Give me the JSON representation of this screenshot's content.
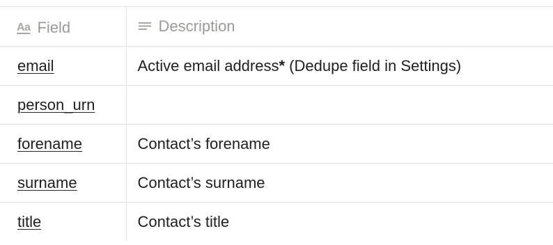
{
  "header": {
    "field_icon": "text-type-icon",
    "field_icon_glyph": "Aa",
    "field_label": "Field",
    "description_icon": "text-lines-icon",
    "description_label": "Description"
  },
  "rows": [
    {
      "field": "email",
      "description_parts": [
        {
          "text": "Active email address",
          "bold": false
        },
        {
          "text": "*",
          "bold": true
        },
        {
          "text": " (Dedupe field in Settings)",
          "bold": false
        }
      ]
    },
    {
      "field": "person_urn",
      "description_parts": []
    },
    {
      "field": "forename",
      "description_parts": [
        {
          "text": "Contact’s forename",
          "bold": false
        }
      ]
    },
    {
      "field": "surname",
      "description_parts": [
        {
          "text": "Contact’s surname",
          "bold": false
        }
      ]
    },
    {
      "field": "title",
      "description_parts": [
        {
          "text": "Contact’s title",
          "bold": false
        }
      ]
    }
  ],
  "colors": {
    "header_text": "#9b9a97",
    "body_text": "#1f1f1f",
    "border": "#e3e3e1"
  }
}
